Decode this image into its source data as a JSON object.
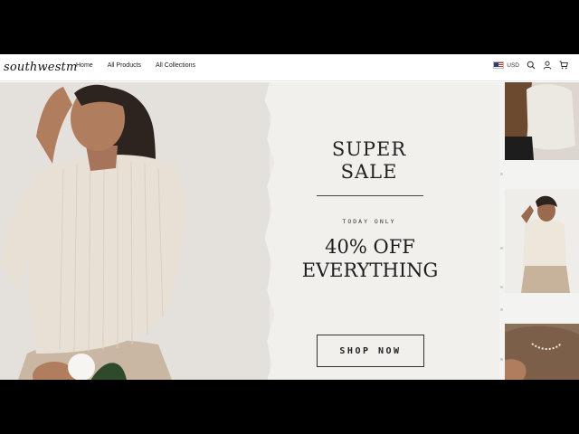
{
  "header": {
    "logo": "southwestm",
    "nav": [
      {
        "label": "Home"
      },
      {
        "label": "All Products"
      },
      {
        "label": "All Collections"
      }
    ],
    "currency": "USD",
    "icons": [
      "us-flag-icon",
      "search-icon",
      "account-icon",
      "cart-icon"
    ]
  },
  "hero": {
    "title_line1": "SUPER",
    "title_line2": "SALE",
    "tagline": "TODAY ONLY",
    "offer_line1": "40% OFF",
    "offer_line2": "EVERYTHING",
    "cta": "SHOP NOW"
  },
  "colors": {
    "background": "#ffffff",
    "paper": "#f1f0ec",
    "text": "#222222",
    "sweater": "#e8e0d4",
    "skin": "#b07d5f",
    "hair": "#2e241f"
  }
}
